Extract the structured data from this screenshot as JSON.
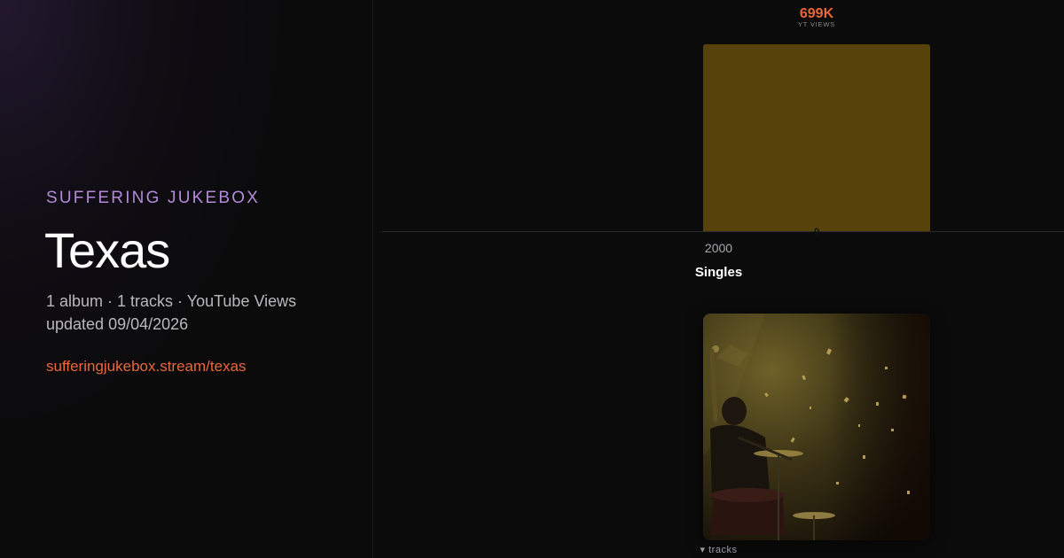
{
  "brand": "SUFFERING JUKEBOX",
  "artist": "Texas",
  "meta_line1": "1 album · 1 tracks · YouTube Views",
  "meta_line2": "updated 09/04/2026",
  "url": "sufferingjukebox.stream/texas",
  "section": {
    "title": "Singles",
    "tracks_toggle": "▾ tracks"
  },
  "colors": {
    "accent_orange": "#e8683c",
    "brand_purple": "#b48ad8",
    "bar_fill": "#57420c"
  },
  "chart_data": {
    "type": "bar",
    "categories": [
      "2000"
    ],
    "series": [
      {
        "values": [
          699000
        ],
        "value_labels": [
          "699K"
        ],
        "markers": [
          "0"
        ]
      }
    ],
    "unit_label": "YT VIEWS",
    "grid": false
  }
}
